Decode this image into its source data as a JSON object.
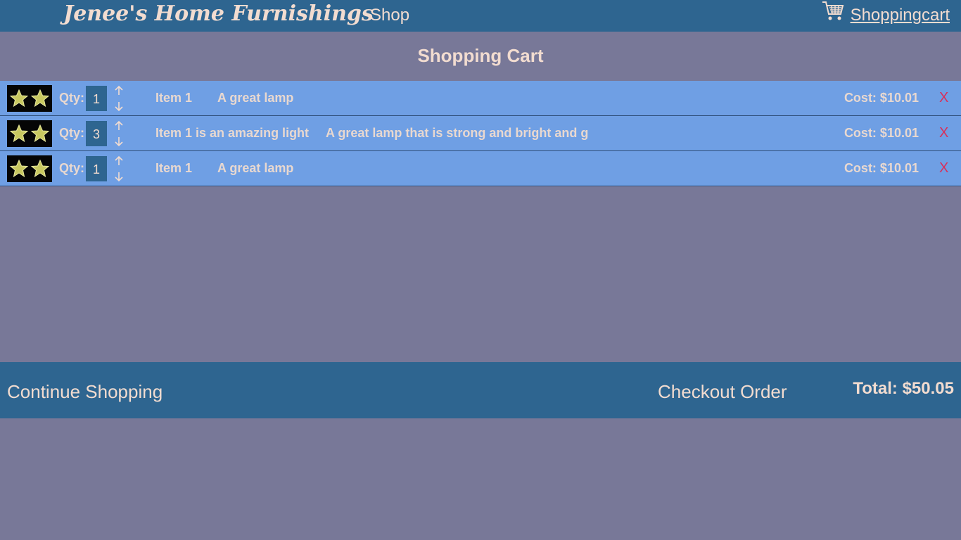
{
  "header": {
    "brand": "Jenee's Home Furnishings",
    "nav_shop": "Shop",
    "cart_link": "Shoppingcart"
  },
  "page": {
    "title": "Shopping Cart"
  },
  "cart": {
    "qty_label": "Qty:",
    "items": [
      {
        "qty": "1",
        "name": "Item 1",
        "description": "A great lamp",
        "cost": "Cost: $10.01",
        "remove": "X"
      },
      {
        "qty": "3",
        "name": "Item 1 is an amazing light",
        "description": "A great lamp that is strong and bright and g",
        "cost": "Cost: $10.01",
        "remove": "X"
      },
      {
        "qty": "1",
        "name": "Item 1",
        "description": "A great lamp",
        "cost": "Cost: $10.01",
        "remove": "X"
      }
    ]
  },
  "footer": {
    "continue": "Continue Shopping",
    "checkout": "Checkout Order",
    "total": "Total: $50.05"
  },
  "colors": {
    "header_bg": "#2e6590",
    "page_bg": "#787898",
    "row_bg": "#6f9fe4",
    "remove": "#d8305a",
    "text": "#f2dcd0"
  }
}
